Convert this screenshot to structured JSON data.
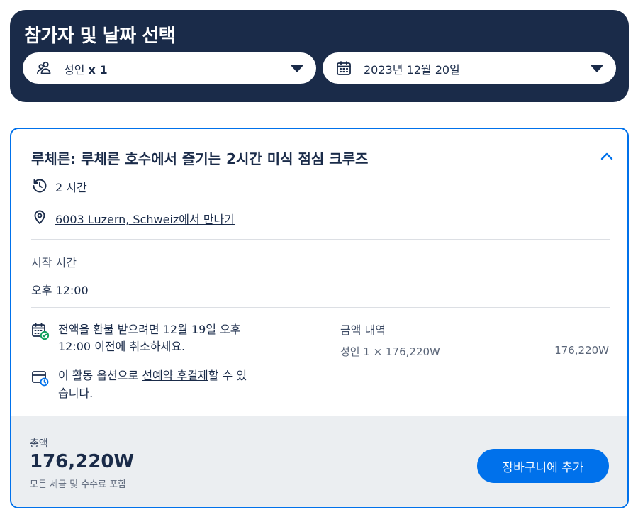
{
  "selector": {
    "title": "참가자 및 날짜 선택",
    "participants_label": "성인",
    "participants_count": "x 1",
    "date_value": "2023년 12월 20일"
  },
  "activity": {
    "title": "루체른: 루체른 호수에서 즐기는 2시간 미식 점심 크루즈",
    "duration": "2 시간",
    "meeting_link": "6003 Luzern, Schweiz",
    "meeting_suffix": "에서 만나기",
    "start_time_label": "시작 시간",
    "start_time_value": "오후 12:00",
    "refund_line1": "전액을 환불 받으려면 12월 19일 오후",
    "refund_line2": "12:00 이전에 취소하세요.",
    "reserve_prefix": "이 활동 옵션으로 ",
    "reserve_link": "선예약 후결제",
    "reserve_suffix": "할 수 있",
    "reserve_line2": "습니다."
  },
  "price": {
    "header": "금액 내역",
    "line_label": "성인 1 × 176,220W",
    "line_amount": "176,220W"
  },
  "footer": {
    "total_label": "총액",
    "total_amount": "176,220W",
    "note": "모든 세금 및 수수료 포함",
    "add_button": "장바구니에 추가"
  },
  "icons": {
    "participants": "people-icon",
    "date": "calendar-icon",
    "dropdown": "caret-down-icon",
    "collapse": "chevron-up-icon",
    "duration": "clock-history-icon",
    "location": "map-pin-icon",
    "refund": "calendar-check-icon",
    "reserve": "wallet-clock-icon"
  },
  "colors": {
    "navy": "#1a2b49",
    "accent": "#0071eb",
    "footer_bg": "#ebeef1",
    "check_green": "#0a9d58"
  }
}
